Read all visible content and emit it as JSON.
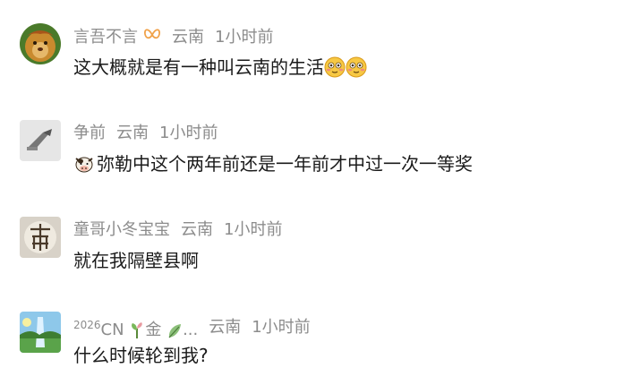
{
  "comments": [
    {
      "username": "言吾不言",
      "location": "云南",
      "time": "1小时前",
      "text": "这大概就是有一种叫云南的生活"
    },
    {
      "username": "争前",
      "location": "云南",
      "time": "1小时前",
      "text": "弥勒中这个两年前还是一年前才中过一次一等奖"
    },
    {
      "username": "童哥小冬宝宝",
      "location": "云南",
      "time": "1小时前",
      "text": "就在我隔壁县啊"
    },
    {
      "username_prefix": "2026",
      "username_cn": "CN",
      "username_char": "金",
      "username_ellipsis": "...",
      "location": "云南",
      "time": "1小时前",
      "text": "什么时候轮到我?"
    }
  ]
}
